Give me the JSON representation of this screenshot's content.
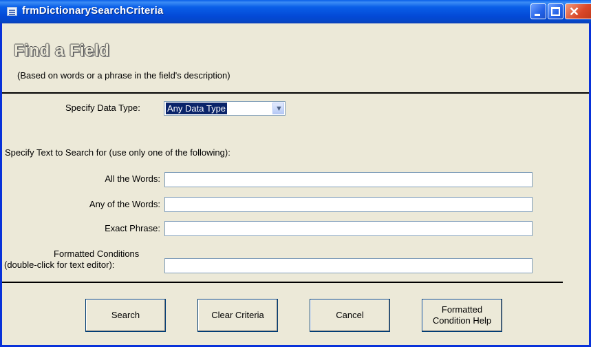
{
  "window": {
    "title": "frmDictionarySearchCriteria",
    "controls": {
      "minimize": "minimize",
      "maximize": "maximize",
      "close": "close"
    }
  },
  "form": {
    "heading": "Find a Field",
    "subheading": "(Based on words or a phrase in the field's description)",
    "data_type": {
      "label": "Specify Data Type:",
      "selected": "Any Data Type"
    },
    "search_text": {
      "instruction": "Specify Text to Search for (use only one of the following):",
      "all_words": {
        "label": "All the Words:",
        "value": ""
      },
      "any_words": {
        "label": "Any of the Words:",
        "value": ""
      },
      "exact_phrase": {
        "label": "Exact Phrase:",
        "value": ""
      },
      "formatted_conditions": {
        "label_line1": "Formatted Conditions",
        "label_line2": "(double-click for text editor):",
        "value": ""
      }
    }
  },
  "buttons": {
    "search": "Search",
    "clear": "Clear Criteria",
    "cancel": "Cancel",
    "help": "Formatted\nCondition Help"
  },
  "colors": {
    "titlebar": "#0a5fe8",
    "window_bg": "#ece9d8",
    "selection": "#0a246a",
    "close_button": "#d9482a"
  },
  "icons": [
    "form-icon",
    "minimize-icon",
    "maximize-icon",
    "close-icon",
    "dropdown-arrow-icon"
  ]
}
